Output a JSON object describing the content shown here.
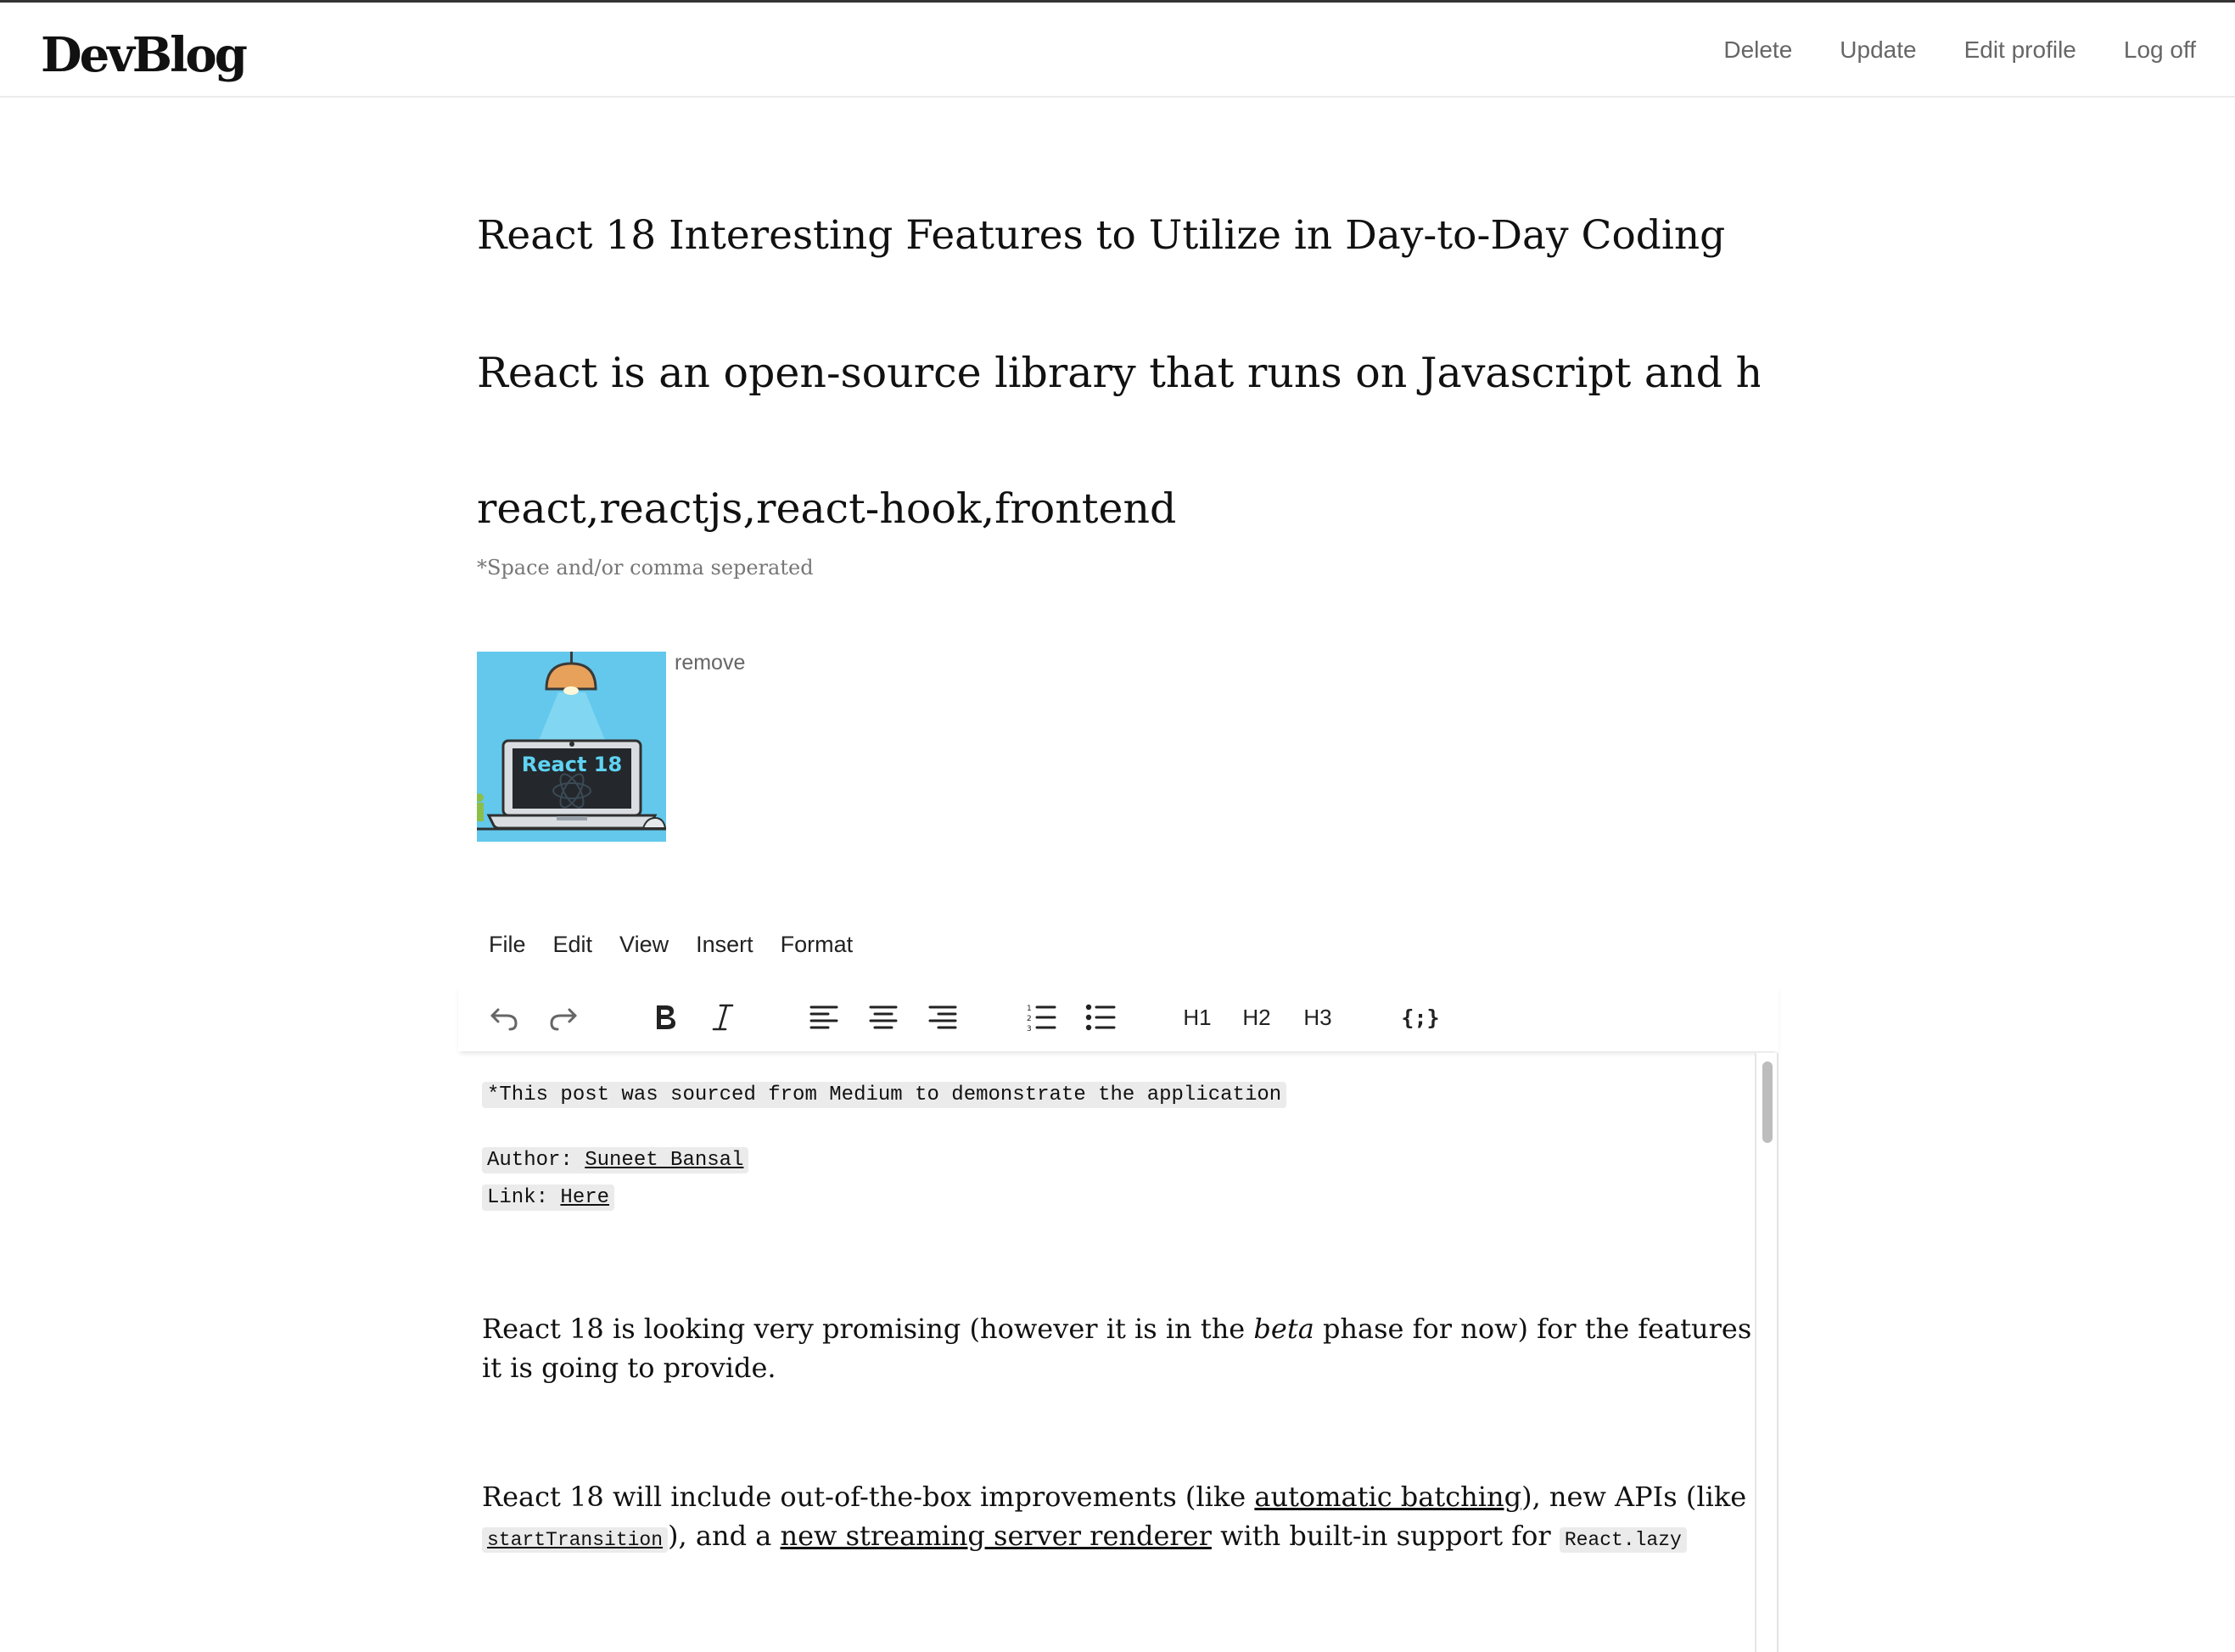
{
  "header": {
    "logo": "DevBlog",
    "nav": {
      "delete": "Delete",
      "update": "Update",
      "edit_profile": "Edit profile",
      "log_off": "Log off"
    }
  },
  "form": {
    "title_value": "React 18 Interesting Features to Utilize in Day-to-Day Coding",
    "description_value": "React is an open-source library that runs on Javascript and has been",
    "tags_value": "react,reactjs,react-hook,frontend",
    "tags_hint": "*Space and/or comma seperated",
    "image_text": "React 18",
    "remove_label": "remove"
  },
  "editor": {
    "menu": [
      "File",
      "Edit",
      "View",
      "Insert",
      "Format"
    ],
    "toolbar": {
      "h1": "H1",
      "h2": "H2",
      "h3": "H3",
      "code_symbol": "{;}"
    },
    "icons": [
      "undo-icon",
      "redo-icon",
      "bold-icon",
      "italic-icon",
      "align-left-icon",
      "align-center-icon",
      "align-right-icon",
      "numbered-list-icon",
      "bullet-list-icon",
      "code-block-icon"
    ],
    "content": {
      "notice": "*This post was sourced from Medium to demonstrate the application",
      "author_label": "Author: ",
      "author_name": "Suneet Bansal",
      "link_label": "Link: ",
      "link_text": "Here",
      "para1_a": "React 18 is looking very promising (however it is in the ",
      "para1_em": "beta",
      "para1_b": " phase for now) for the features it is going to provide.",
      "para2_a": "React 18 will include out-of-the-box improvements (like ",
      "para2_link1": "automatic batching",
      "para2_b": "), new APIs (like ",
      "para2_code1": "startTransition",
      "para2_c": "), and a ",
      "para2_link2": "new streaming server renderer",
      "para2_d": " with built-in support for ",
      "para2_code2": "React.lazy"
    }
  },
  "colors": {
    "image_background": "#63c8ec",
    "lamp": "#e8a15a",
    "screen_text": "#5fd3f3"
  }
}
